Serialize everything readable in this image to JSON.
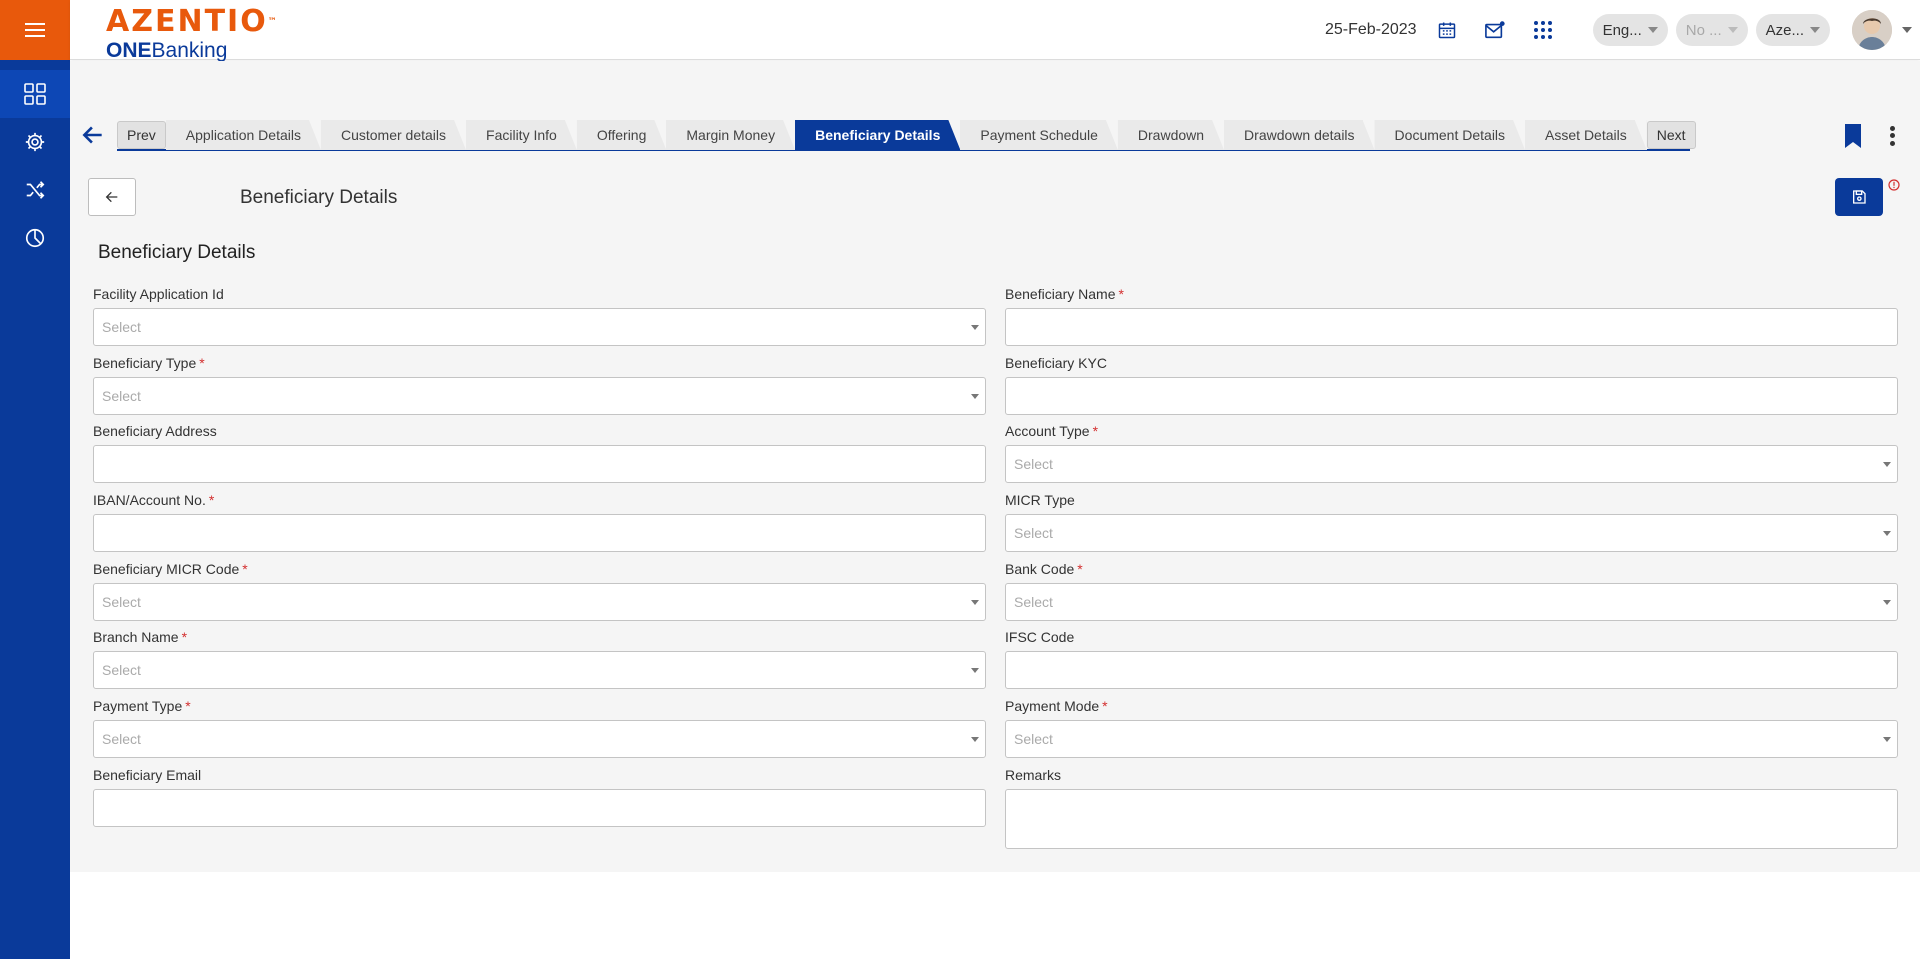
{
  "app": {
    "logo_main": "AZENTIO",
    "logo_tm": "™",
    "logo_sub_bold": "ONE",
    "logo_sub_rest": "Banking"
  },
  "header": {
    "date": "25-Feb-2023",
    "language": "Eng...",
    "selector_2": "No ...",
    "selector_3": "Aze..."
  },
  "sidebar": {
    "items": [
      "dashboard-grid-icon",
      "settings-gear-icon",
      "shuffle-icon",
      "pie-chart-icon"
    ]
  },
  "tabs": {
    "prev": "Prev",
    "next": "Next",
    "items": [
      {
        "label": "Application Details"
      },
      {
        "label": "Customer details"
      },
      {
        "label": "Facility Info"
      },
      {
        "label": "Offering"
      },
      {
        "label": "Margin Money"
      },
      {
        "label": "Beneficiary Details"
      },
      {
        "label": "Payment Schedule"
      },
      {
        "label": "Drawdown"
      },
      {
        "label": "Drawdown details"
      },
      {
        "label": "Document Details"
      },
      {
        "label": "Asset Details"
      }
    ],
    "active_index": 5
  },
  "page": {
    "title": "Beneficiary Details",
    "section_title": "Beneficiary Details"
  },
  "form": {
    "left": [
      {
        "label": "Facility Application Id",
        "required": false,
        "type": "select",
        "placeholder": "Select"
      },
      {
        "label": "Beneficiary Type",
        "required": true,
        "type": "select",
        "placeholder": "Select"
      },
      {
        "label": "Beneficiary Address",
        "required": false,
        "type": "text",
        "placeholder": ""
      },
      {
        "label": "IBAN/Account No.",
        "required": true,
        "type": "text",
        "placeholder": ""
      },
      {
        "label": "Beneficiary MICR Code",
        "required": true,
        "type": "select",
        "placeholder": "Select"
      },
      {
        "label": "Branch Name",
        "required": true,
        "type": "select",
        "placeholder": "Select"
      },
      {
        "label": "Payment Type",
        "required": true,
        "type": "select",
        "placeholder": "Select"
      },
      {
        "label": "Beneficiary Email",
        "required": false,
        "type": "text",
        "placeholder": ""
      }
    ],
    "right": [
      {
        "label": "Beneficiary Name",
        "required": true,
        "type": "text",
        "placeholder": ""
      },
      {
        "label": "Beneficiary KYC",
        "required": false,
        "type": "text",
        "placeholder": ""
      },
      {
        "label": "Account Type",
        "required": true,
        "type": "select",
        "placeholder": "Select"
      },
      {
        "label": "MICR Type",
        "required": false,
        "type": "select",
        "placeholder": "Select"
      },
      {
        "label": "Bank Code",
        "required": true,
        "type": "select",
        "placeholder": "Select"
      },
      {
        "label": "IFSC Code",
        "required": false,
        "type": "text",
        "placeholder": ""
      },
      {
        "label": "Payment Mode",
        "required": true,
        "type": "select",
        "placeholder": "Select"
      },
      {
        "label": "Remarks",
        "required": false,
        "type": "textarea",
        "placeholder": ""
      }
    ],
    "required_marker": "*"
  },
  "colors": {
    "brand_orange": "#e8590c",
    "brand_blue": "#0a3a9a",
    "required_red": "#d32f2f"
  }
}
